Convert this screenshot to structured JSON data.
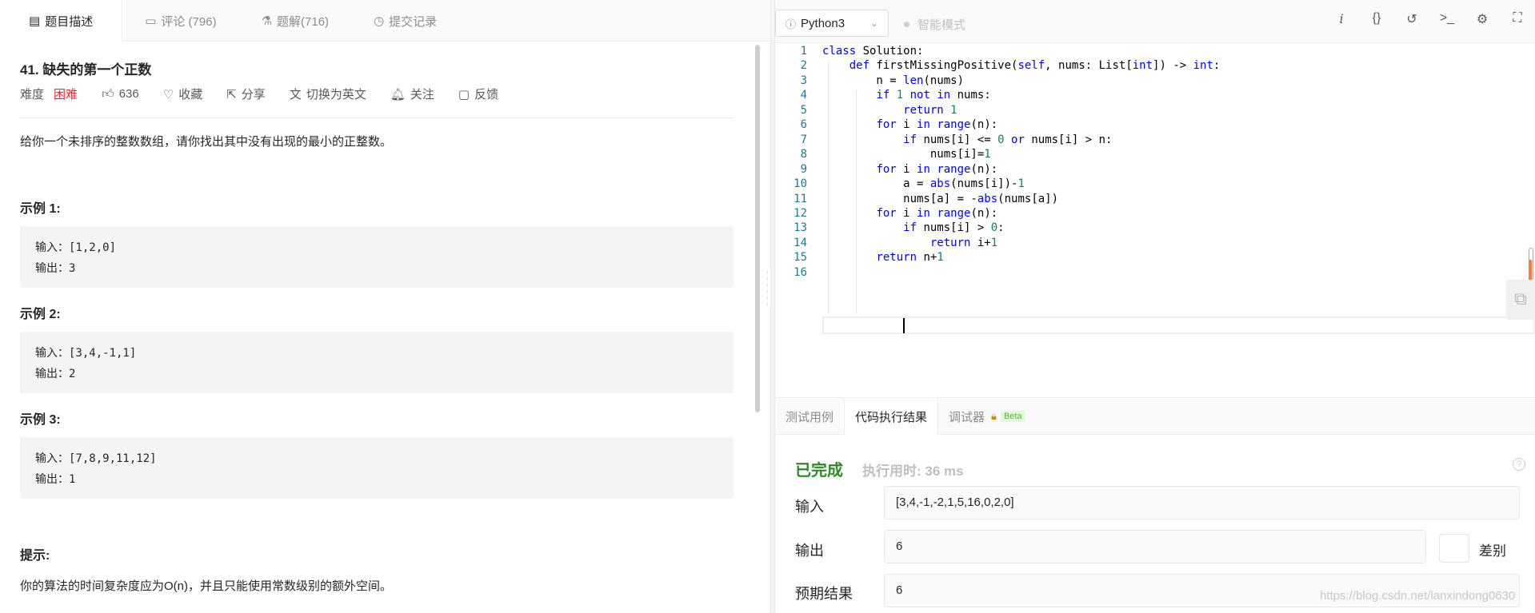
{
  "left_tabs": [
    {
      "icon": "description-icon",
      "glyph": "▤",
      "label": "题目描述"
    },
    {
      "icon": "comment-icon",
      "glyph": "▭",
      "label": "评论 (796)"
    },
    {
      "icon": "flask-icon",
      "glyph": "⚗",
      "label": "题解(716)"
    },
    {
      "icon": "history-icon",
      "glyph": "◷",
      "label": "提交记录"
    }
  ],
  "problem": {
    "title": "41. 缺失的第一个正数",
    "difficulty_label": "难度",
    "difficulty": "困难",
    "likes": "636",
    "favorite": "收藏",
    "share": "分享",
    "switch_lang": "切换为英文",
    "follow": "关注",
    "feedback": "反馈",
    "description": "给你一个未排序的整数数组，请你找出其中没有出现的最小的正整数。",
    "examples": [
      {
        "title": "示例 1:",
        "input": "输入：[1,2,0]",
        "output": "输出：3"
      },
      {
        "title": "示例 2:",
        "input": "输入：[3,4,-1,1]",
        "output": "输出：2"
      },
      {
        "title": "示例 3:",
        "input": "输入：[7,8,9,11,12]",
        "output": "输出：1"
      }
    ],
    "hint_title": "提示:",
    "hint": "你的算法的时间复杂度应为O(n)，并且只能使用常数级别的额外空间。"
  },
  "toolbar": {
    "language": "Python3",
    "smart_mode": "智能模式",
    "icons": [
      "info-icon",
      "braces-icon",
      "reset-icon",
      "terminal-icon",
      "settings-icon",
      "fullscreen-icon"
    ]
  },
  "code_lines": [
    "class Solution:",
    "    def firstMissingPositive(self, nums: List[int]) -> int:",
    "        n = len(nums)",
    "        if 1 not in nums:",
    "            return 1",
    "        for i in range(n):",
    "            if nums[i] <= 0 or nums[i] > n:",
    "                nums[i]=1",
    "        for i in range(n):",
    "            a = abs(nums[i])-1",
    "            nums[a] = -abs(nums[a])",
    "        for i in range(n):",
    "            if nums[i] > 0:",
    "                return i+1",
    "        return n+1",
    "            "
  ],
  "result_tabs": {
    "testcase": "测试用例",
    "result": "代码执行结果",
    "debugger": "调试器",
    "beta": "Beta"
  },
  "result": {
    "status": "已完成",
    "time": "执行用时: 36 ms",
    "input_label": "输入",
    "input_value": "[3,4,-1,-2,1,5,16,0,2,0]",
    "output_label": "输出",
    "output_value": "6",
    "diff_label": "差别",
    "expected_label": "预期结果",
    "expected_value": "6"
  },
  "watermark": "https://blog.csdn.net/lanxindong0630"
}
